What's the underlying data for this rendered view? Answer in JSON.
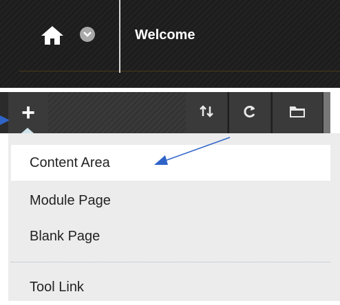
{
  "header": {
    "title": "Welcome"
  },
  "icons": {
    "home": "home-icon",
    "chevron": "chevron-down-icon",
    "add": "plus-icon",
    "sort": "sort-icon",
    "refresh": "refresh-icon",
    "folder": "folder-icon"
  },
  "toolbar": {
    "add_label": "+"
  },
  "menu": {
    "items": [
      {
        "label": "Content Area"
      },
      {
        "label": "Module Page"
      },
      {
        "label": "Blank Page"
      },
      {
        "label": "Tool Link"
      }
    ]
  },
  "colors": {
    "header_bg": "#222222",
    "menu_bg": "#ececec",
    "accent_arrow": "#2f64c8"
  }
}
